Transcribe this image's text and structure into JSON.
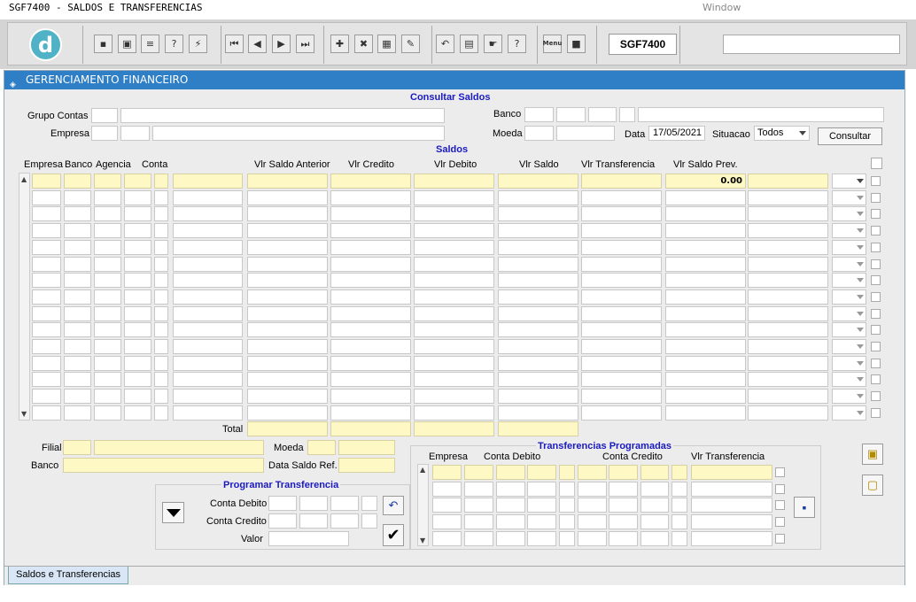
{
  "app": {
    "title": "SGF7400 - SALDOS E TRANSFERENCIAS",
    "window_menu": "Window",
    "screen_code": "SGF7400",
    "logo_glyph": "d"
  },
  "toolbar": {
    "icons": [
      "save-icon",
      "window-icon",
      "print-icon",
      "help-query-icon",
      "run-query-icon",
      "first-record-icon",
      "prev-record-icon",
      "next-record-icon",
      "last-record-icon",
      "insert-record-icon",
      "delete-record-icon",
      "clear-record-icon",
      "edit-icon",
      "undo-icon",
      "clipboard-icon",
      "tools-icon",
      "help-icon",
      "menu-icon",
      "exit-icon"
    ],
    "glyphs": [
      "▪",
      "▣",
      "≡",
      "?",
      "⚡",
      "⏮",
      "◀",
      "▶",
      "⏭",
      "✚",
      "✖",
      "▦",
      "✎",
      "↶",
      "▤",
      "☛",
      "?",
      "▤",
      "■"
    ],
    "menu_label": "Menu"
  },
  "form": {
    "title": "GERENCIAMENTO FINANCEIRO"
  },
  "consultar": {
    "title": "Consultar Saldos",
    "grupo_contas_label": "Grupo Contas",
    "empresa_label": "Empresa",
    "banco_label": "Banco",
    "moeda_label": "Moeda",
    "data_label": "Data",
    "data_value": "17/05/2021",
    "situacao_label": "Situacao",
    "situacao_value": "Todos",
    "consultar_button": "Consultar"
  },
  "saldos": {
    "title": "Saldos",
    "columns": [
      "Empresa",
      "Banco",
      "Agencia",
      "Conta",
      "Vlr Saldo Anterior",
      "Vlr Credito",
      "Vlr Debito",
      "Vlr Saldo",
      "Vlr Transferencia",
      "Vlr Saldo Prev."
    ],
    "first_row_saldo_prev": "0.00",
    "total_label": "Total"
  },
  "detalhe": {
    "filial_label": "Filial",
    "banco_label": "Banco",
    "moeda_label": "Moeda",
    "data_saldo_label": "Data Saldo Ref."
  },
  "programar": {
    "title": "Programar Transferencia",
    "conta_debito_label": "Conta Debito",
    "conta_credito_label": "Conta Credito",
    "valor_label": "Valor"
  },
  "transferencias": {
    "title": "Transferencias Programadas",
    "columns": [
      "Empresa",
      "Conta Debito",
      "Conta Credito",
      "Vlr Transferencia"
    ]
  },
  "tabs": [
    {
      "label": "Saldos e Transferencias"
    }
  ],
  "colors": {
    "header_blue": "#2e7fc6",
    "section_title": "#1a1ac2",
    "field_yellow": "#fdf8c4"
  }
}
